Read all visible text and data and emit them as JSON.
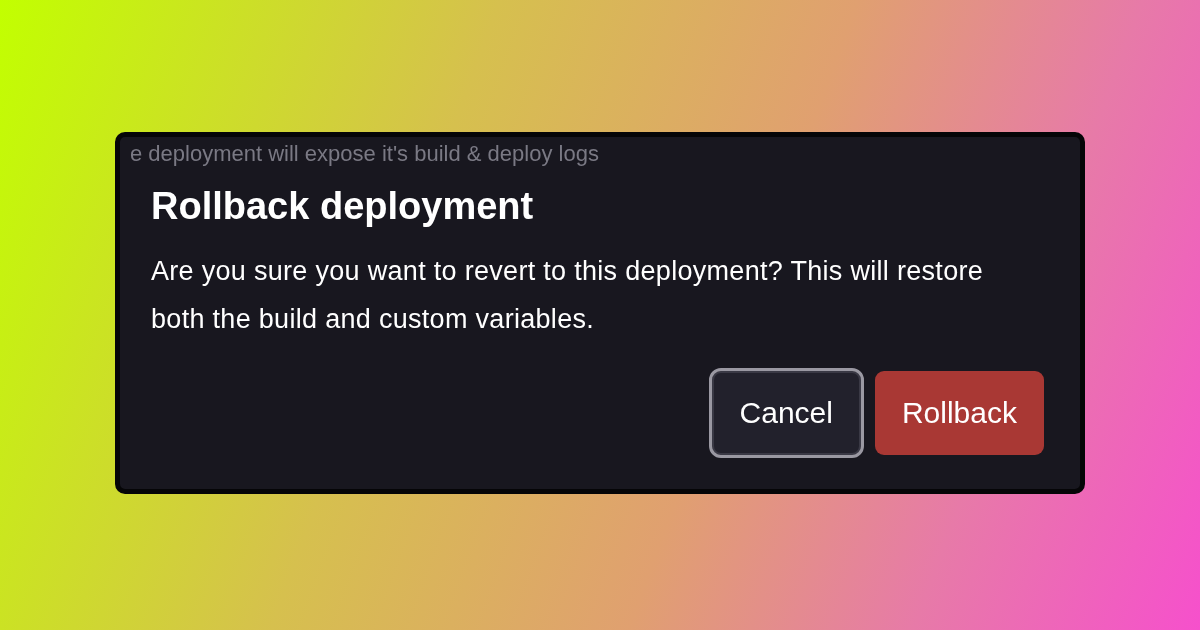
{
  "background_text": "e deployment will expose it's build & deploy logs",
  "dialog": {
    "title": "Rollback deployment",
    "message": "Are you sure you want to revert to this deployment? This will restore both the build and custom variables.",
    "buttons": [
      {
        "label": "Cancel",
        "kind": "secondary",
        "focused": true
      },
      {
        "label": "Rollback",
        "kind": "danger",
        "focused": false
      }
    ]
  }
}
